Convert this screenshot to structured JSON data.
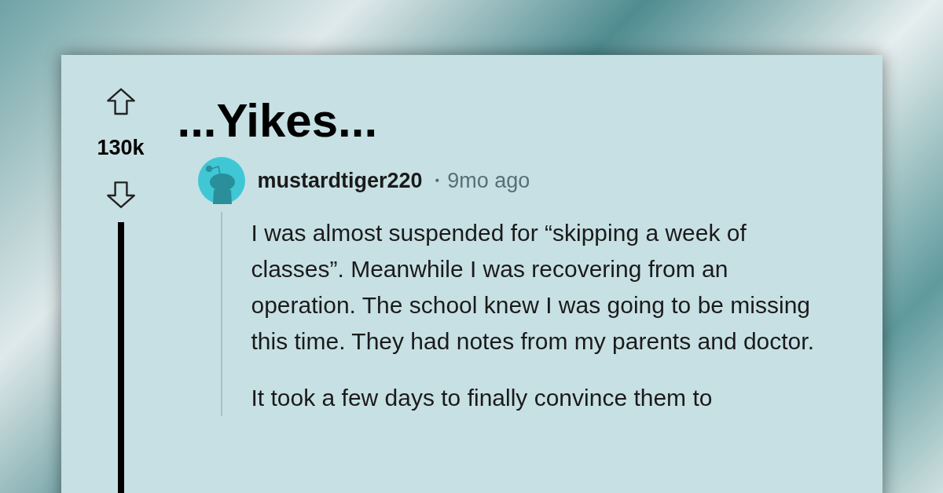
{
  "post": {
    "votes": "130k",
    "title": "...Yikes..."
  },
  "comment": {
    "author": "mustardtiger220",
    "separator": "•",
    "time": "9mo ago",
    "paragraphs": [
      "I was almost suspended for “skipping a week of classes”. Meanwhile I was recovering from an operation. The school knew I was going to be missing this time. They had notes from my parents and doctor.",
      "It took a few days to finally convince them to"
    ]
  }
}
